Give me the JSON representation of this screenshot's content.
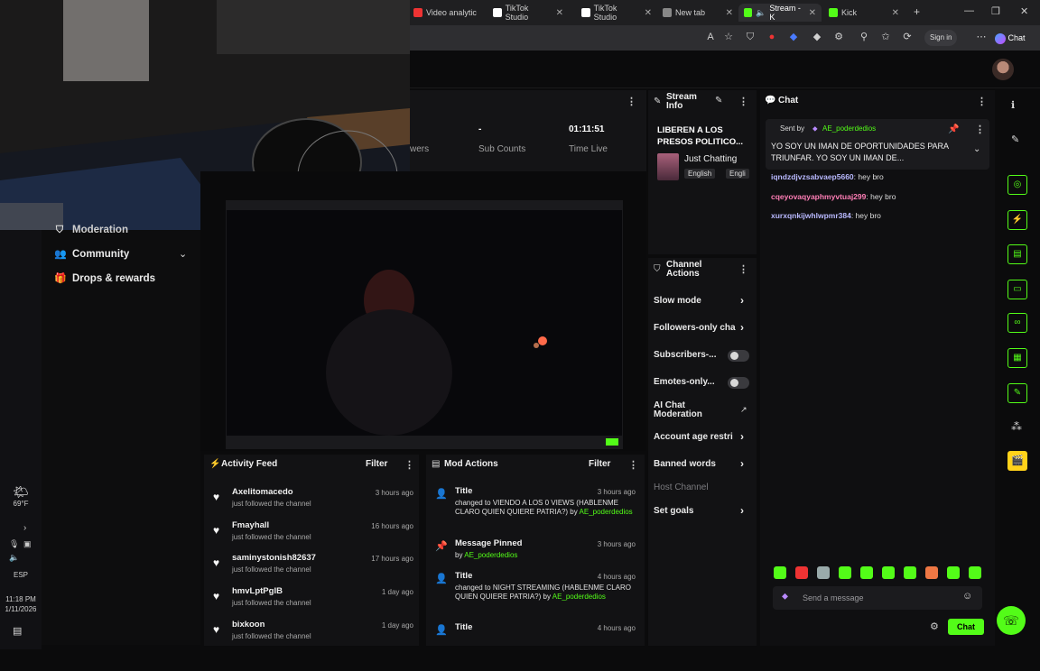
{
  "browser": {
    "tabs": [
      {
        "label": "Video analytic",
        "active": false
      },
      {
        "label": "TikTok Studio",
        "active": false
      },
      {
        "label": "TikTok Studio",
        "active": false
      },
      {
        "label": "New tab",
        "active": false
      },
      {
        "label": "Stream - K",
        "active": true
      },
      {
        "label": "Kick",
        "active": false
      }
    ],
    "signin_label": "Sign in",
    "chat_label": "Chat"
  },
  "stats": {
    "viewers_label": "wers",
    "sub_counts_value": "-",
    "sub_counts_label": "Sub Counts",
    "time_live_value": "01:11:51",
    "time_live_label": "Time Live"
  },
  "leftnav": {
    "items": [
      {
        "label": "Moderation",
        "icon": "shield-icon"
      },
      {
        "label": "Community",
        "icon": "people-icon"
      },
      {
        "label": "Drops & rewards",
        "icon": "gift-icon"
      }
    ]
  },
  "windows": {
    "weather_temp": "69°F",
    "lang": "ESP",
    "time": "11:18 PM",
    "date": "1/11/2026"
  },
  "stream_info": {
    "title_label": "Stream Info",
    "stream_title": "LIBEREN A LOS PRESOS POLITICO...",
    "category": "Just Chatting",
    "tags": [
      "English",
      "Engli"
    ]
  },
  "channel_actions": {
    "title": "Channel Actions",
    "rows": [
      {
        "label": "Slow mode",
        "control": "chevron"
      },
      {
        "label": "Followers-only cha",
        "control": "chevron"
      },
      {
        "label": "Subscribers-...",
        "control": "toggle"
      },
      {
        "label": "Emotes-only...",
        "control": "toggle"
      },
      {
        "label": "AI Chat Moderation",
        "control": "external"
      },
      {
        "label": "Account age restri",
        "control": "chevron"
      },
      {
        "label": "Banned words",
        "control": "chevron"
      },
      {
        "label": "Host Channel",
        "control": "none"
      },
      {
        "label": "Set goals",
        "control": "chevron"
      }
    ]
  },
  "activity_feed": {
    "title": "Activity Feed",
    "filter_label": "Filter",
    "items": [
      {
        "name": "Axelitomacedo",
        "sub": "just followed the channel",
        "time": "3 hours ago"
      },
      {
        "name": "Fmayhall",
        "sub": "just followed the channel",
        "time": "16 hours ago"
      },
      {
        "name": "saminystonish82637",
        "sub": "just followed the channel",
        "time": "17 hours ago"
      },
      {
        "name": "hmvLptPgIB",
        "sub": "just followed the channel",
        "time": "1 day ago"
      },
      {
        "name": "bixkoon",
        "sub": "just followed the channel",
        "time": "1 day ago"
      }
    ]
  },
  "mod_actions": {
    "title": "Mod Actions",
    "filter_label": "Filter",
    "items": [
      {
        "heading": "Title",
        "text": "changed to VIENDO A LOS 0 VIEWS (HABLENME CLARO QUIEN QUIERE PATRIA?) by",
        "by": "AE_poderdedios",
        "time": "3 hours ago"
      },
      {
        "heading": "Message Pinned",
        "text": "by",
        "by": "AE_poderdedios",
        "time": "3 hours ago"
      },
      {
        "heading": "Title",
        "text": "changed to NIGHT STREAMING (HABLENME CLARO QUIEN QUIERE PATRIA?) by",
        "by": "AE_poderdedios",
        "time": "4 hours ago"
      },
      {
        "heading": "Title",
        "text": "",
        "by": "",
        "time": "4 hours ago"
      }
    ]
  },
  "chat": {
    "title": "Chat",
    "pinned_by_label": "Sent by",
    "pinned_by_user": "AE_poderdedios",
    "pinned_text": "YO SOY UN IMAN DE OPORTUNIDADES PARA TRIUNFAR. YO SOY UN IMAN DE...",
    "messages": [
      {
        "user": "iqndzdjvzsabvaep5660",
        "text": "hey bro",
        "color": "#b9b9ff"
      },
      {
        "user": "cqeyovaqyaphmyvtuaj299",
        "text": "hey bro",
        "color": "#ff7eb6"
      },
      {
        "user": "xurxqnkijwhlwpmr384",
        "text": "hey bro",
        "color": "#b9b9ff"
      }
    ],
    "input_placeholder": "Send a message",
    "send_label": "Chat"
  },
  "colors": {
    "accent": "#53fc18",
    "panel": "#121214",
    "background": "#0b0b0c"
  }
}
